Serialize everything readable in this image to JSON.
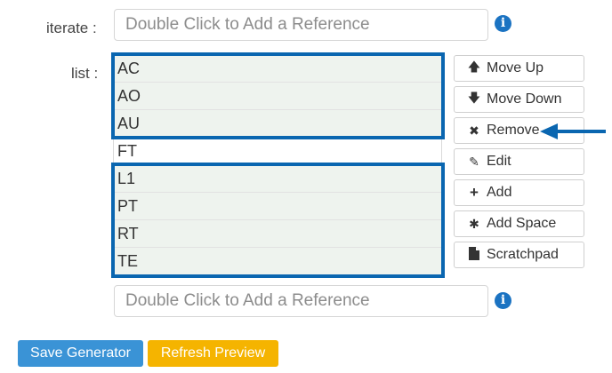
{
  "iterate": {
    "label": "iterate :",
    "placeholder": "Double Click to Add a Reference"
  },
  "list": {
    "label": "list :",
    "items": [
      "AC",
      "AO",
      "AU",
      "FT",
      "L1",
      "PT",
      "RT",
      "TE"
    ],
    "selected": [
      "AC",
      "AO",
      "AU",
      "L1",
      "PT",
      "RT",
      "TE"
    ],
    "new_item_placeholder": "Double Click to Add a Reference"
  },
  "buttons": {
    "move_up": "Move Up",
    "move_down": "Move Down",
    "remove": "Remove",
    "edit": "Edit",
    "add": "Add",
    "add_space": "Add Space",
    "scratchpad": "Scratchpad"
  },
  "actions": {
    "save": "Save Generator",
    "refresh": "Refresh Preview"
  },
  "colors": {
    "highlight": "#0a66b0",
    "save_bg": "#3a93d6",
    "refresh_bg": "#f5b400",
    "info": "#1b73c2"
  },
  "icons": {
    "move_up": "arrow-up-icon",
    "move_down": "arrow-down-icon",
    "remove": "x-icon",
    "edit": "pencil-icon",
    "add": "plus-icon",
    "add_space": "asterisk-icon",
    "scratchpad": "file-icon",
    "info": "info-icon",
    "pointer": "arrow-left-icon"
  }
}
